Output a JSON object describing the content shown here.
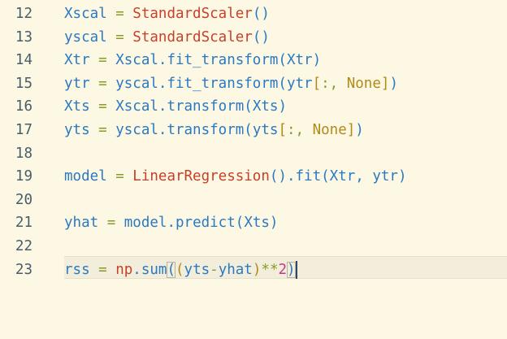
{
  "editor": {
    "lines": [
      {
        "num": "12",
        "tokens": [
          [
            "Xscal",
            "t-var"
          ],
          [
            " = ",
            "t-op"
          ],
          [
            "StandardScaler",
            "t-cls"
          ],
          [
            "()",
            "t-p1"
          ]
        ]
      },
      {
        "num": "13",
        "tokens": [
          [
            "yscal",
            "t-var"
          ],
          [
            " = ",
            "t-op"
          ],
          [
            "StandardScaler",
            "t-cls"
          ],
          [
            "()",
            "t-p1"
          ]
        ]
      },
      {
        "num": "14",
        "tokens": [
          [
            "Xtr",
            "t-var"
          ],
          [
            " = ",
            "t-op"
          ],
          [
            "Xscal",
            "t-var"
          ],
          [
            ".",
            "t-punc"
          ],
          [
            "fit_transform",
            "t-fn"
          ],
          [
            "(",
            "t-p1"
          ],
          [
            "Xtr",
            "t-var"
          ],
          [
            ")",
            "t-p1"
          ]
        ]
      },
      {
        "num": "15",
        "tokens": [
          [
            "ytr",
            "t-var"
          ],
          [
            " = ",
            "t-op"
          ],
          [
            "yscal",
            "t-var"
          ],
          [
            ".",
            "t-punc"
          ],
          [
            "fit_transform",
            "t-fn"
          ],
          [
            "(",
            "t-p1"
          ],
          [
            "ytr",
            "t-var"
          ],
          [
            "[",
            "t-p2"
          ],
          [
            ":, ",
            "t-slice"
          ],
          [
            "None",
            "t-kw"
          ],
          [
            "]",
            "t-p2"
          ],
          [
            ")",
            "t-p1"
          ]
        ]
      },
      {
        "num": "16",
        "tokens": [
          [
            "Xts",
            "t-var"
          ],
          [
            " = ",
            "t-op"
          ],
          [
            "Xscal",
            "t-var"
          ],
          [
            ".",
            "t-punc"
          ],
          [
            "transform",
            "t-fn"
          ],
          [
            "(",
            "t-p1"
          ],
          [
            "Xts",
            "t-var"
          ],
          [
            ")",
            "t-p1"
          ]
        ]
      },
      {
        "num": "17",
        "tokens": [
          [
            "yts",
            "t-var"
          ],
          [
            " = ",
            "t-op"
          ],
          [
            "yscal",
            "t-var"
          ],
          [
            ".",
            "t-punc"
          ],
          [
            "transform",
            "t-fn"
          ],
          [
            "(",
            "t-p1"
          ],
          [
            "yts",
            "t-var"
          ],
          [
            "[",
            "t-p2"
          ],
          [
            ":, ",
            "t-slice"
          ],
          [
            "None",
            "t-kw"
          ],
          [
            "]",
            "t-p2"
          ],
          [
            ")",
            "t-p1"
          ]
        ]
      },
      {
        "num": "18",
        "tokens": []
      },
      {
        "num": "19",
        "tokens": [
          [
            "model",
            "t-var"
          ],
          [
            " = ",
            "t-op"
          ],
          [
            "LinearRegression",
            "t-cls"
          ],
          [
            "()",
            "t-p1"
          ],
          [
            ".",
            "t-punc"
          ],
          [
            "fit",
            "t-fn"
          ],
          [
            "(",
            "t-p1"
          ],
          [
            "Xtr",
            "t-var"
          ],
          [
            ", ",
            "t-punc"
          ],
          [
            "ytr",
            "t-var"
          ],
          [
            ")",
            "t-p1"
          ]
        ]
      },
      {
        "num": "20",
        "tokens": []
      },
      {
        "num": "21",
        "tokens": [
          [
            "yhat",
            "t-var"
          ],
          [
            " = ",
            "t-op"
          ],
          [
            "model",
            "t-var"
          ],
          [
            ".",
            "t-punc"
          ],
          [
            "predict",
            "t-fn"
          ],
          [
            "(",
            "t-p1"
          ],
          [
            "Xts",
            "t-var"
          ],
          [
            ")",
            "t-p1"
          ]
        ]
      },
      {
        "num": "22",
        "tokens": []
      },
      {
        "num": "23",
        "current": true,
        "tokens": [
          [
            "rss",
            "t-var"
          ],
          [
            " = ",
            "t-op"
          ],
          [
            "np",
            "t-np"
          ],
          [
            ".",
            "t-punc"
          ],
          [
            "sum",
            "t-fn"
          ],
          [
            "(",
            "t-p1 bracket-match"
          ],
          [
            "(",
            "t-p2"
          ],
          [
            "yts",
            "t-var"
          ],
          [
            "-",
            "t-op"
          ],
          [
            "yhat",
            "t-var"
          ],
          [
            ")",
            "t-p2"
          ],
          [
            "**",
            "t-op"
          ],
          [
            "2",
            "t-num"
          ],
          [
            ")",
            "t-p1 bracket-match"
          ]
        ]
      }
    ],
    "colors": {
      "background": "#fdf8e3",
      "line_number": "#485d6a",
      "identifier": "#2a79c2",
      "operator": "#8a9a2a",
      "class_name": "#c6402a",
      "keyword": "#b28a1a",
      "number": "#c33b88"
    }
  }
}
